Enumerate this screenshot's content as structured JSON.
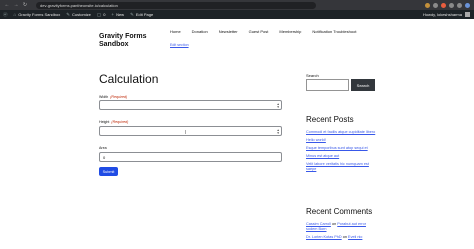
{
  "browser": {
    "url": "dev-gravityforms.pantheonsite.io/calculation",
    "nav": [
      "←",
      "→",
      "↻"
    ]
  },
  "adminbar": {
    "site": "Gravity Forms Sandbox",
    "customize": "Customize",
    "comments_count": "0",
    "new": "New",
    "edit_page": "Edit Page",
    "howdy": "Howdy, lokeshsharma"
  },
  "header": {
    "site_title": "Gravity Forms Sandbox",
    "nav": [
      "Home",
      "Donation",
      "Newsletter",
      "Guest Post",
      "Membership",
      "Notification Troubleshoot"
    ],
    "edit_link": "Edit section"
  },
  "main": {
    "title": "Calculation",
    "fields": [
      {
        "label": "Width",
        "required": "(Required)",
        "value": ""
      },
      {
        "label": "Height",
        "required": "(Required)",
        "value": ""
      },
      {
        "label": "Area",
        "required": "",
        "value": "0"
      }
    ],
    "submit": "Submit"
  },
  "sidebar": {
    "search_label": "Search",
    "search_button": "Search",
    "recent_posts_heading": "Recent Posts",
    "recent_posts": [
      "Commodi et facilis atque cupiditate libero",
      "Hello world!",
      "Esque temporibus sunt atop sequi et",
      "Minus est atque aut",
      "Velit labore veritatis hic numquam est saepe"
    ],
    "recent_comments_heading": "Recent Comments",
    "recent_comments": [
      {
        "author": "Cassim Carroll",
        "on": "on",
        "post": "Porabut aut error sodem Born"
      },
      {
        "author": "Dr. Lorien Kotas PhD",
        "on": "on",
        "post": "Eveli nio"
      }
    ]
  }
}
